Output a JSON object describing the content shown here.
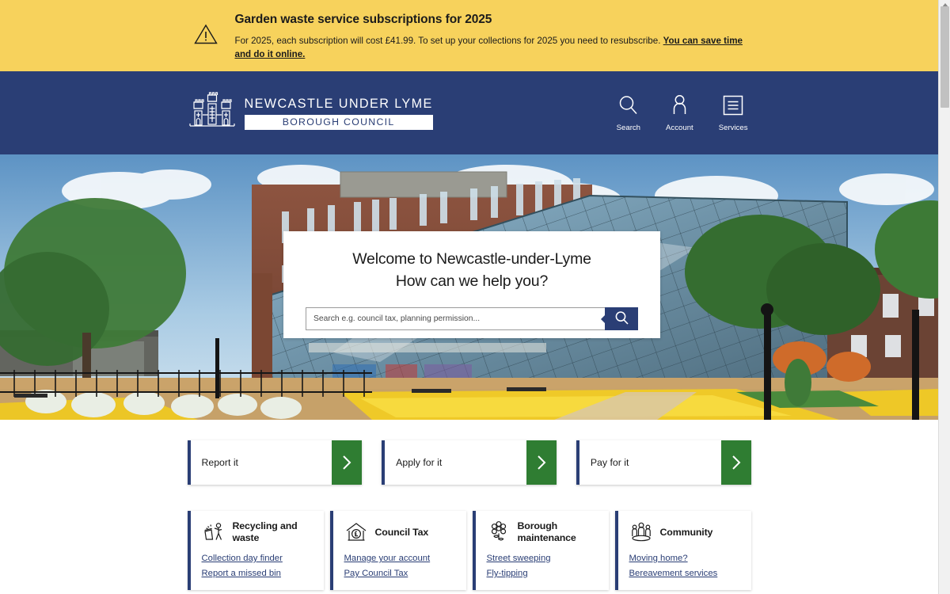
{
  "alert": {
    "icon": "warning-triangle-icon",
    "title": "Garden waste service subscriptions for 2025",
    "body_before": "For 2025, each subscription will cost £41.99. To set up your collections for 2025 you need to resubscribe. ",
    "link_text": "You can save time and do it online."
  },
  "header": {
    "logo_line1": "NEWCASTLE UNDER LYME",
    "logo_line2": "BOROUGH COUNCIL",
    "logo_icon": "castle-icon",
    "nav": [
      {
        "label": "Search",
        "icon": "search-icon"
      },
      {
        "label": "Account",
        "icon": "person-icon"
      },
      {
        "label": "Services",
        "icon": "menu-box-icon"
      }
    ]
  },
  "hero": {
    "title_line1": "Welcome to Newcastle-under-Lyme",
    "title_line2": "How can we help you?",
    "search_placeholder": "Search e.g. council tax, planning permission...",
    "search_value": "",
    "search_button_icon": "search-icon"
  },
  "actions": [
    {
      "label": "Report it",
      "icon": "chevron-right-icon"
    },
    {
      "label": "Apply for it",
      "icon": "chevron-right-icon"
    },
    {
      "label": "Pay for it",
      "icon": "chevron-right-icon"
    }
  ],
  "services": [
    {
      "title": "Recycling and waste",
      "icon": "bin-person-icon",
      "links": [
        "Collection day finder",
        "Report a missed bin"
      ]
    },
    {
      "title": "Council Tax",
      "icon": "house-pound-icon",
      "links": [
        "Manage your account",
        "Pay Council Tax"
      ]
    },
    {
      "title": "Borough maintenance",
      "icon": "flower-icon",
      "links": [
        "Street sweeping",
        "Fly-tipping"
      ]
    },
    {
      "title": "Community",
      "icon": "people-group-icon",
      "links": [
        "Moving home?",
        "Bereavement services"
      ]
    }
  ],
  "colors": {
    "alert_yellow": "#f7d25c",
    "navy": "#2a3e75",
    "green": "#2f7d32",
    "link_navy": "#2a3e75"
  }
}
